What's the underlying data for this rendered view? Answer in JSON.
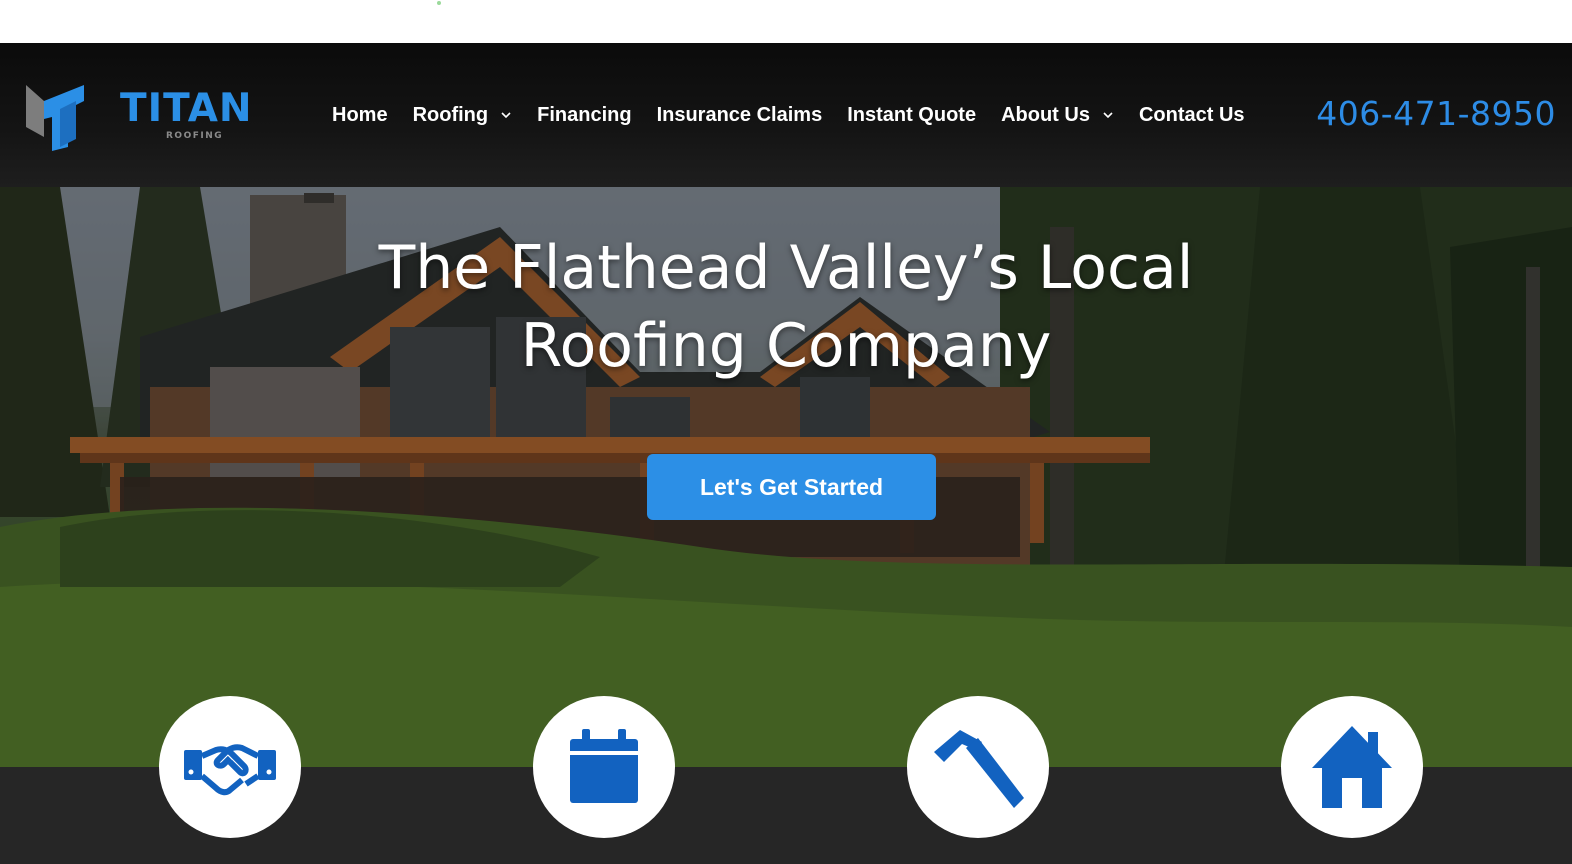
{
  "brand": {
    "name": "TITAN",
    "tagline": "ROOFING",
    "accent_color": "#2b8fe6",
    "logo_icon": "titan-t-logo-icon"
  },
  "nav": {
    "items": [
      {
        "label": "Home",
        "has_dropdown": false
      },
      {
        "label": "Roofing",
        "has_dropdown": true
      },
      {
        "label": "Financing",
        "has_dropdown": false
      },
      {
        "label": "Insurance Claims",
        "has_dropdown": false
      },
      {
        "label": "Instant Quote",
        "has_dropdown": false
      },
      {
        "label": "About Us",
        "has_dropdown": true
      },
      {
        "label": "Contact Us",
        "has_dropdown": false
      }
    ],
    "dropdown_icon": "chevron-down-icon"
  },
  "phone": "406-471-8950",
  "hero": {
    "title_line1": "The Flathead Valley’s Local",
    "title_line2": "Roofing Company",
    "cta_label": "Let's Get Started",
    "background": "log-home-with-pine-trees-photo"
  },
  "features": {
    "icons": [
      "handshake-icon",
      "calendar-icon",
      "hammer-icon",
      "house-icon"
    ],
    "icon_color": "#1262c0"
  }
}
